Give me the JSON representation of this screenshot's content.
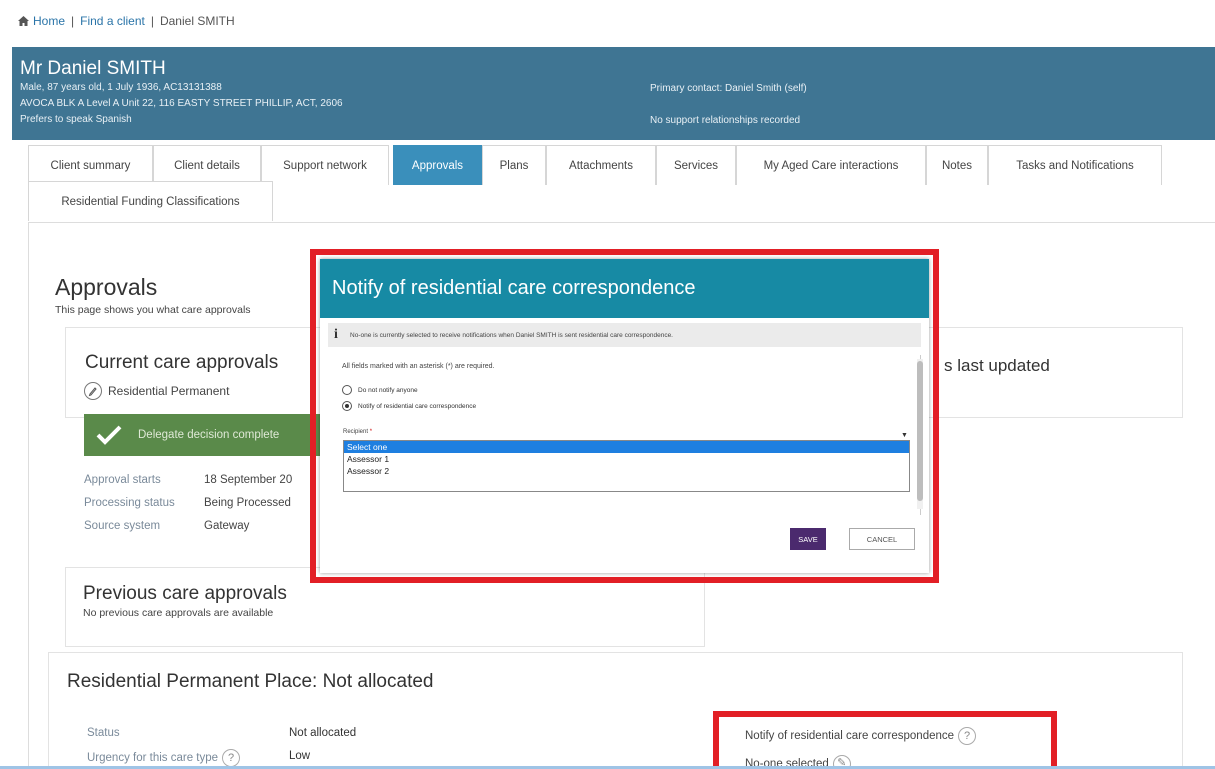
{
  "breadcrumb": {
    "home": "Home",
    "find_client": "Find a client",
    "current": "Daniel SMITH"
  },
  "client": {
    "name": "Mr Daniel SMITH",
    "details": "Male, 87 years old, 1 July 1936, AC13131388",
    "address": "AVOCA BLK A Level A Unit 22, 116 EASTY STREET PHILLIP, ACT, 2606",
    "language": "Prefers to speak Spanish",
    "primary_contact": "Primary contact: Daniel Smith (self)",
    "support": "No support relationships recorded"
  },
  "tabs": [
    {
      "label": "Client summary"
    },
    {
      "label": "Client details"
    },
    {
      "label": "Support network"
    },
    {
      "label": "Approvals"
    },
    {
      "label": "Plans"
    },
    {
      "label": "Attachments"
    },
    {
      "label": "Services"
    },
    {
      "label": "My Aged Care interactions"
    },
    {
      "label": "Notes"
    },
    {
      "label": "Tasks and Notifications"
    },
    {
      "label": "Residential Funding Classifications"
    }
  ],
  "approvals": {
    "title": "Approvals",
    "description": "This page shows you what care approvals",
    "current_title": "Current care approvals",
    "residential_permanent": "Residential Permanent",
    "last_updated": "s last updated",
    "delegate_text": "Delegate decision complete",
    "approval_starts_label": "Approval starts",
    "approval_starts_value": "18 September 20",
    "processing_status_label": "Processing status",
    "processing_status_value": "Being Processed",
    "source_system_label": "Source system",
    "source_system_value": "Gateway",
    "previous_title": "Previous care approvals",
    "previous_desc": "No previous care approvals are available"
  },
  "residential_place": {
    "title": "Residential Permanent Place: Not allocated",
    "status_label": "Status",
    "status_value": "Not allocated",
    "urgency_label": "Urgency for this care type",
    "urgency_value": "Low",
    "notify_label": "Notify of residential care correspondence",
    "notify_value": "No-one selected"
  },
  "modal": {
    "title": "Notify of residential care correspondence",
    "info": "No-one is currently selected to receive notifications when Daniel SMITH is sent residential care correspondence.",
    "required_note": "All fields marked with an asterisk (*) are required.",
    "option_none": "Do not notify anyone",
    "option_notify": "Notify of residential care correspondence",
    "recipient_label": "Recipient",
    "dropdown_options": [
      "Select one",
      "Assessor 1",
      "Assessor 2"
    ],
    "save": "SAVE",
    "cancel": "CANCEL"
  },
  "colors": {
    "header_bg": "#3f7593",
    "modal_header": "#178aa4",
    "active_tab": "#3a8fbb",
    "highlight_red": "#e21f26",
    "save_btn": "#4b2a6e",
    "delegate_green": "#5a8a4a"
  }
}
